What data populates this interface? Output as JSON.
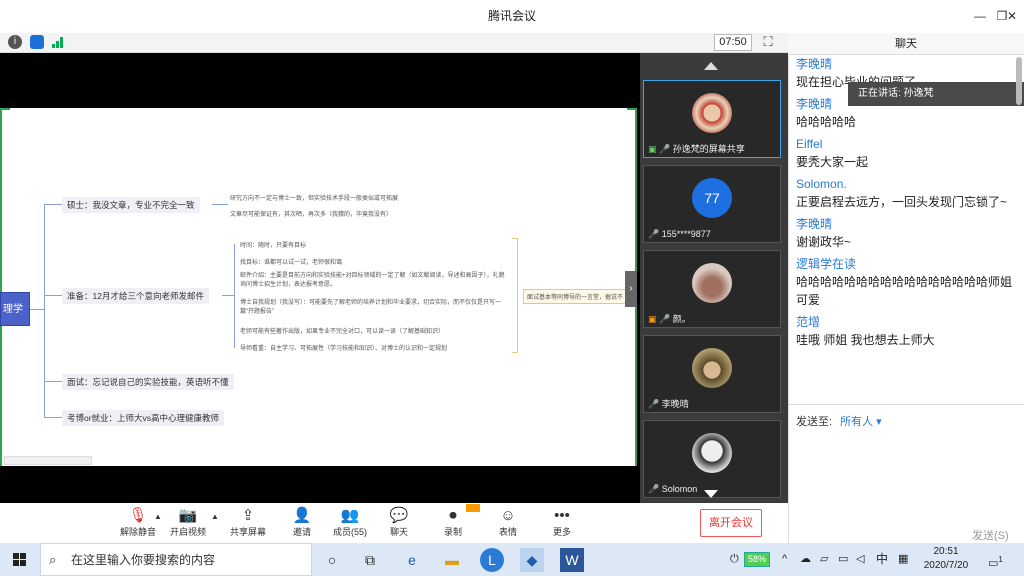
{
  "window": {
    "title": "腾讯会议",
    "minimize": "—",
    "restore": "❐",
    "close": "✕"
  },
  "infobar": {
    "timer": "07:50"
  },
  "slide": {
    "root_label": "理学",
    "branches": [
      {
        "label": "硕士：我没文章，专业不完全一致",
        "leaves": [
          "研究方向不一定与博士一致，但实验技术手段一般类似或可拓展",
          "文章尽可能保证有，其次晒，再次多（我猜的，毕竟我没有）"
        ]
      },
      {
        "label": "准备：12月才给三个意向老师发邮件",
        "leaves": [
          "时间：随时，只要有目标",
          "找目标：谁都可以试一试，老师很和蔼",
          "邮件介绍：主要是目前方向和实验技能+对目标领域的一定了解（如文献阅读，导述和高因子），礼貌询问博士招生计划，表达报考意愿。",
          "博士自我规划（我没写）：可能要先了解老师的培养计划和毕业要求，切合实际，而不仅仅是只写一篇“开题报告”",
          "老师可能有些著作出版，如果专业不完全对口，可以读一读（了解基础知识）",
          "导师看重：自主学习、可拓展性（学习技能和知识）、对博士的认识和一定规划"
        ]
      },
      {
        "label": "面试：忘记说自己的实验技能，英语听不懂",
        "leaves": []
      },
      {
        "label": "考博or就业：上师大vs高中心理健康教师",
        "leaves": []
      }
    ],
    "side_note": "面试基本等同博导的一言堂，据说不"
  },
  "participants": [
    {
      "name": "孙逸梵的屏幕共享",
      "active": true
    },
    {
      "name": "155****9877",
      "avatar_text": "77",
      "active": false
    },
    {
      "name": "颜。",
      "active": false
    },
    {
      "name": "李晚晴",
      "active": false
    },
    {
      "name": "Solomon",
      "active": false
    }
  ],
  "toolbar": {
    "buttons": [
      {
        "icon": "🎙",
        "label": "解除静音"
      },
      {
        "icon": "📷",
        "label": "开启视频"
      },
      {
        "icon": "⇪",
        "label": "共享屏幕"
      },
      {
        "icon": "👤",
        "label": "邀请"
      },
      {
        "icon": "👥",
        "label": "成员(55)"
      },
      {
        "icon": "💬",
        "label": "聊天"
      },
      {
        "icon": "⏺",
        "label": "录制"
      },
      {
        "icon": "☺",
        "label": "表情"
      },
      {
        "icon": "•••",
        "label": "更多"
      }
    ],
    "leave": "离开会议"
  },
  "chat": {
    "title": "聊天",
    "speaking": "正在讲话: 孙逸梵",
    "messages": [
      {
        "sender": "李晚晴",
        "text": "现在担心毕业的问题了"
      },
      {
        "sender": "李晚晴",
        "text": "哈哈哈哈哈"
      },
      {
        "sender": "Eiffel",
        "text": "要秃大家一起"
      },
      {
        "sender": "Solomon.",
        "text": "正要启程去远方，一回头发现门忘锁了~"
      },
      {
        "sender": "李晚晴",
        "text": "谢谢政华~"
      },
      {
        "sender": "逻辑学在读",
        "text": "哈哈哈哈哈哈哈哈哈哈哈哈哈哈哈哈师姐可爱"
      },
      {
        "sender": "范增",
        "text": " 哇哦 师姐 我也想去上师大"
      }
    ],
    "send_to_label": "发送至:",
    "send_to_target": "所有人 ▾",
    "send_button": "发送(S)"
  },
  "taskbar": {
    "search_placeholder": "在这里输入你要搜索的内容",
    "battery": "58%",
    "ime": "中",
    "time": "20:51",
    "date": "2020/7/20",
    "notifications": "1"
  }
}
